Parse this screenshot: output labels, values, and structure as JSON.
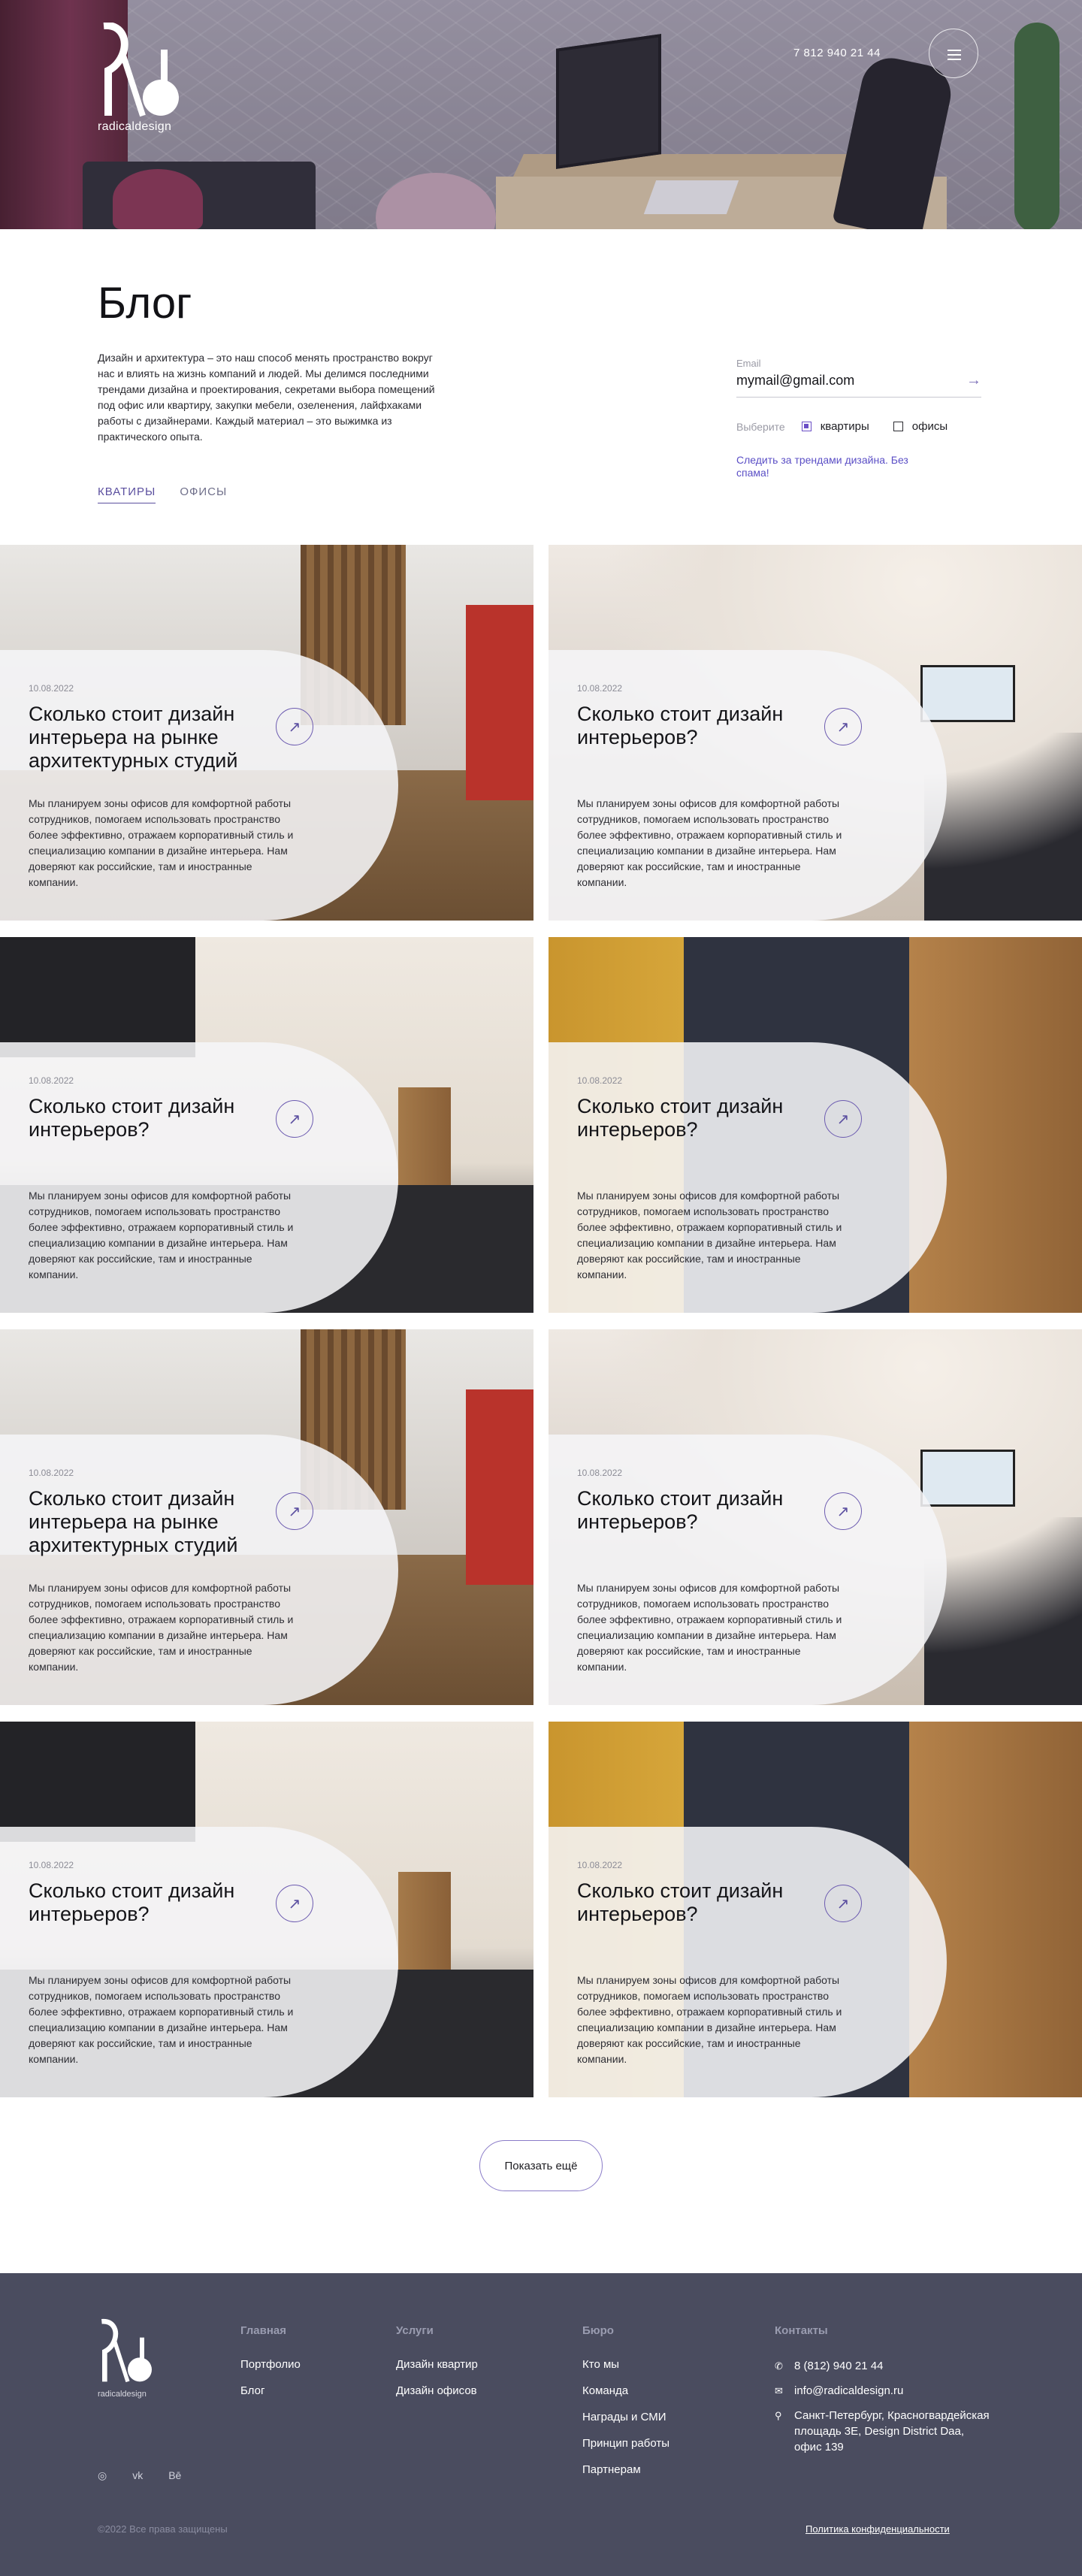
{
  "header": {
    "logo_text": "radicaldesign",
    "phone": "7 812 940 21 44",
    "menu_icon": "hamburger-icon"
  },
  "page": {
    "title": "Блог",
    "intro": "Дизайн и архитектура – это наш способ менять пространство вокруг нас и влиять на жизнь компаний и людей. Мы делимся последними трендами дизайна и проектирования, секретами выбора помещений под офис или квартиру, закупки мебели, озеленения, лайфхаками работы с дизайнерами. Каждый материал – это выжимка из практического опыта.",
    "tabs": [
      {
        "label": "КВАТИРЫ",
        "active": true
      },
      {
        "label": "ОФИСЫ",
        "active": false
      }
    ]
  },
  "subscribe": {
    "label": "Email",
    "value": "mymail@gmail.com",
    "choose_label": "Выберите",
    "options": [
      {
        "label": "квартиры",
        "checked": true
      },
      {
        "label": "офисы",
        "checked": false
      }
    ],
    "note": "Следить за трендами дизайна. Без спама!",
    "accent_color": "#5b4fc6"
  },
  "posts": [
    {
      "date": "10.08.2022",
      "title": "Сколько стоит дизайн интерьера на рынке архитектурных студий",
      "desc": "Мы планируем зоны офисов для комфортной работы сотрудников, помогаем использовать пространство более эффективно, отражаем корпоративный стиль и специализацию компании в дизайне интерьера. Нам доверяют как российские, там и иностранные компании."
    },
    {
      "date": "10.08.2022",
      "title": "Сколько стоит дизайн интерьеров?",
      "desc": "Мы планируем зоны офисов для комфортной работы сотрудников, помогаем использовать пространство более эффективно, отражаем корпоративный стиль и специализацию компании в дизайне интерьера. Нам доверяют как российские, там и иностранные компании."
    },
    {
      "date": "10.08.2022",
      "title": "Сколько стоит дизайн интерьеров?",
      "desc": "Мы планируем зоны офисов для комфортной работы сотрудников, помогаем использовать пространство более эффективно, отражаем корпоративный стиль и специализацию компании в дизайне интерьера. Нам доверяют как российские, там и иностранные компании."
    },
    {
      "date": "10.08.2022",
      "title": "Сколько стоит дизайн интерьеров?",
      "desc": "Мы планируем зоны офисов для комфортной работы сотрудников, помогаем использовать пространство более эффективно, отражаем корпоративный стиль и специализацию компании в дизайне интерьера. Нам доверяют как российские, там и иностранные компании."
    },
    {
      "date": "10.08.2022",
      "title": "Сколько стоит дизайн интерьера на рынке архитектурных студий",
      "desc": "Мы планируем зоны офисов для комфортной работы сотрудников, помогаем использовать пространство более эффективно, отражаем корпоративный стиль и специализацию компании в дизайне интерьера. Нам доверяют как российские, там и иностранные компании."
    },
    {
      "date": "10.08.2022",
      "title": "Сколько стоит дизайн интерьеров?",
      "desc": "Мы планируем зоны офисов для комфортной работы сотрудников, помогаем использовать пространство более эффективно, отражаем корпоративный стиль и специализацию компании в дизайне интерьера. Нам доверяют как российские, там и иностранные компании."
    },
    {
      "date": "10.08.2022",
      "title": "Сколько стоит дизайн интерьеров?",
      "desc": "Мы планируем зоны офисов для комфортной работы сотрудников, помогаем использовать пространство более эффективно, отражаем корпоративный стиль и специализацию компании в дизайне интерьера. Нам доверяют как российские, там и иностранные компании."
    },
    {
      "date": "10.08.2022",
      "title": "Сколько стоит дизайн интерьеров?",
      "desc": "Мы планируем зоны офисов для комфортной работы сотрудников, помогаем использовать пространство более эффективно, отражаем корпоративный стиль и специализацию компании в дизайне интерьера. Нам доверяют как российские, там и иностранные компании."
    }
  ],
  "more_button": "Показать ещё",
  "footer": {
    "logo_text": "radicaldesign",
    "cols": [
      {
        "title": "Главная",
        "links": [
          "Портфолио",
          "Блог"
        ]
      },
      {
        "title": "Услуги",
        "links": [
          "Дизайн квартир",
          "Дизайн офисов"
        ]
      },
      {
        "title": "Бюро",
        "links": [
          "Кто мы",
          "Команда",
          "Награды и СМИ",
          "Принцип работы",
          "Партнерам"
        ]
      }
    ],
    "contacts_title": "Контакты",
    "phone": "8 (812) 940 21 44",
    "email": "info@radicaldesign.ru",
    "address": "Санкт-Петербург, Красногвардейская площадь 3Е, Design District Daa, офис 139",
    "social": [
      "instagram-icon",
      "vk-icon",
      "behance-icon"
    ],
    "social_labels": [
      "◎",
      "vk",
      "Bē"
    ],
    "copyright": "©2022 Все права защищены",
    "privacy": "Политика конфиденциальности"
  }
}
